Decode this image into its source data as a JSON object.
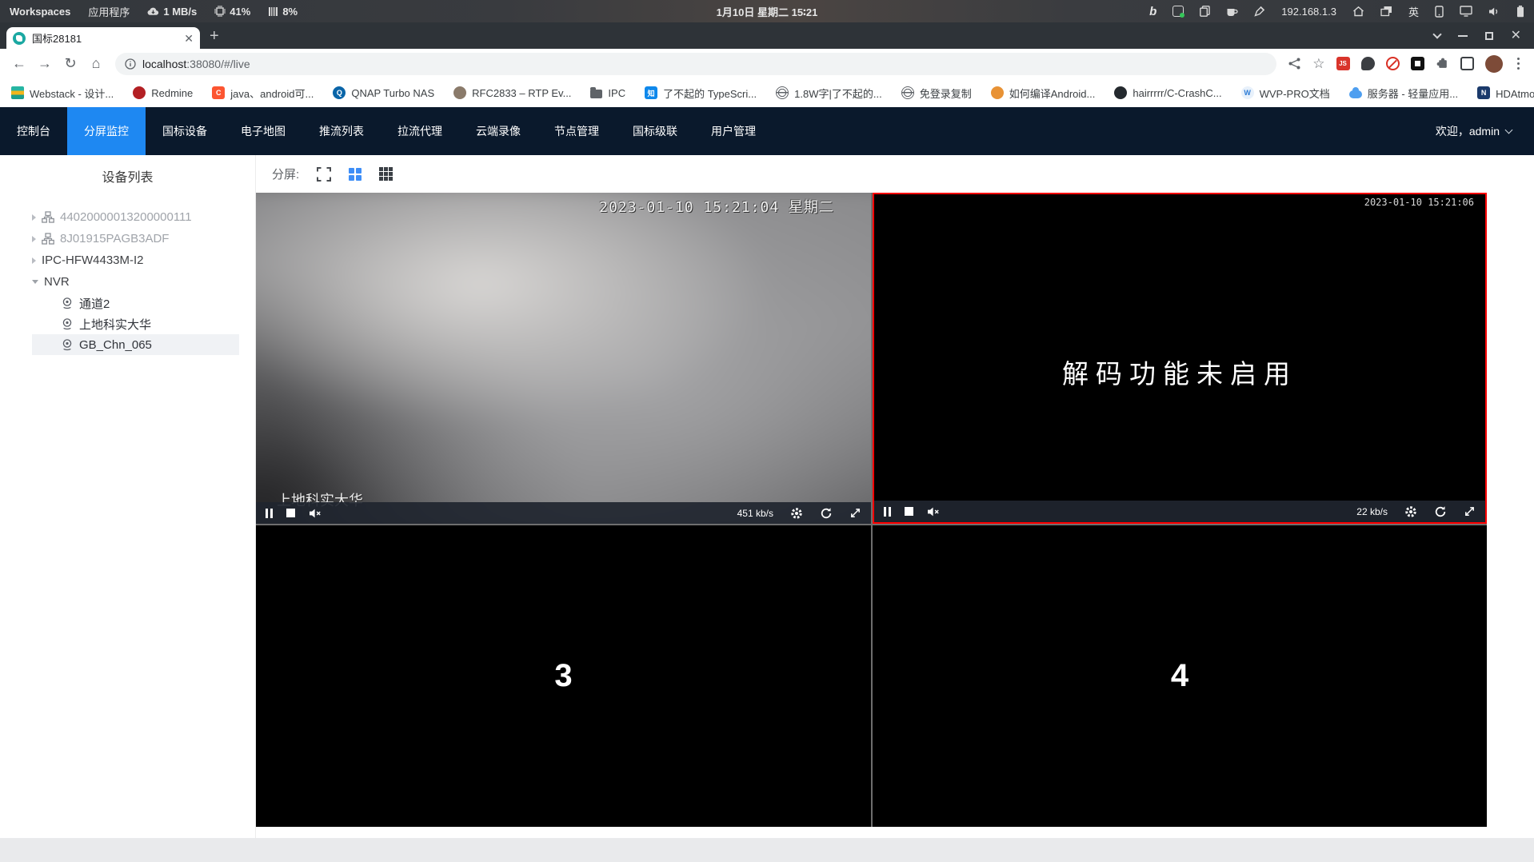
{
  "system_bar": {
    "workspaces_label": "Workspaces",
    "applications_label": "应用程序",
    "network_speed": "1 MB/s",
    "cpu_usage": "41%",
    "memory_usage": "8%",
    "clock": "1月10日 星期二 15∶21",
    "ip_address": "192.168.1.3",
    "input_language": "英",
    "right_icons": [
      "bing",
      "screenshot-app",
      "clipboard",
      "coffee",
      "color-picker",
      "home",
      "workspace-switcher",
      "phone",
      "display",
      "volume",
      "battery"
    ]
  },
  "browser": {
    "tab_title": "国标28181",
    "new_tab_label": "+",
    "url_host": "localhost",
    "url_path": ":38080/#/live",
    "bookmarks": [
      {
        "icon": "webstack",
        "label": "Webstack - 设计..."
      },
      {
        "icon": "redmine",
        "label": "Redmine"
      },
      {
        "icon": "csdn",
        "label": "java、android可..."
      },
      {
        "icon": "qnap",
        "label": "QNAP Turbo NAS"
      },
      {
        "icon": "rfc-avatar",
        "label": "RFC2833 – RTP Ev..."
      },
      {
        "icon": "folder",
        "label": "IPC"
      },
      {
        "icon": "zhihu",
        "label": "了不起的 TypeScri..."
      },
      {
        "icon": "globe",
        "label": "1.8W字|了不起的..."
      },
      {
        "icon": "globe",
        "label": "免登录复制"
      },
      {
        "icon": "android",
        "label": "如何编译Android..."
      },
      {
        "icon": "github",
        "label": "hairrrrr/C-CrashC..."
      },
      {
        "icon": "wvp",
        "label": "WVP-PRO文档"
      },
      {
        "icon": "cloud",
        "label": "服务器 - 轻量应用..."
      },
      {
        "icon": "hdatmos",
        "label": "HDAtmos :: 种子 *..."
      }
    ],
    "bookmarks_overflow": "»"
  },
  "nav": {
    "items": [
      "控制台",
      "分屏监控",
      "国标设备",
      "电子地图",
      "推流列表",
      "拉流代理",
      "云端录像",
      "节点管理",
      "国标级联",
      "用户管理"
    ],
    "active_item": "分屏监控",
    "welcome": "欢迎，admin"
  },
  "sidebar": {
    "title": "设备列表",
    "tree": [
      {
        "label": "44020000013200000111",
        "icon": "device-tree",
        "state": "collapsed",
        "status": "offline"
      },
      {
        "label": "8J01915PAGB3ADF",
        "icon": "device-tree",
        "state": "collapsed",
        "status": "offline"
      },
      {
        "label": "IPC-HFW4433M-I2",
        "state": "collapsed",
        "status": "online"
      },
      {
        "label": "NVR",
        "state": "expanded",
        "status": "online",
        "children": [
          {
            "label": "通道2",
            "icon": "camera"
          },
          {
            "label": "上地科实大华",
            "icon": "camera"
          },
          {
            "label": "GB_Chn_065",
            "icon": "camera",
            "selected": true
          }
        ]
      }
    ]
  },
  "toolbar": {
    "split_label": "分屏:",
    "layouts": [
      "fullscreen",
      "grid-2x2",
      "grid-3x3"
    ],
    "active_layout": "grid-2x2"
  },
  "videos": {
    "cell1": {
      "osd_time": "2023-01-10 15:21:04 星期二",
      "osd_name": "上地科实大华",
      "bitrate": "451 kb/s"
    },
    "cell2": {
      "osd_time": "2023-01-10 15:21:06",
      "message": "解码功能未启用",
      "bitrate": "22 kb/s",
      "selected": true
    },
    "cell3": {
      "label": "3"
    },
    "cell4": {
      "label": "4"
    }
  },
  "colors": {
    "accent": "#1e88f2",
    "selected_border": "#ff0000",
    "nav_background": "#0a192c"
  }
}
